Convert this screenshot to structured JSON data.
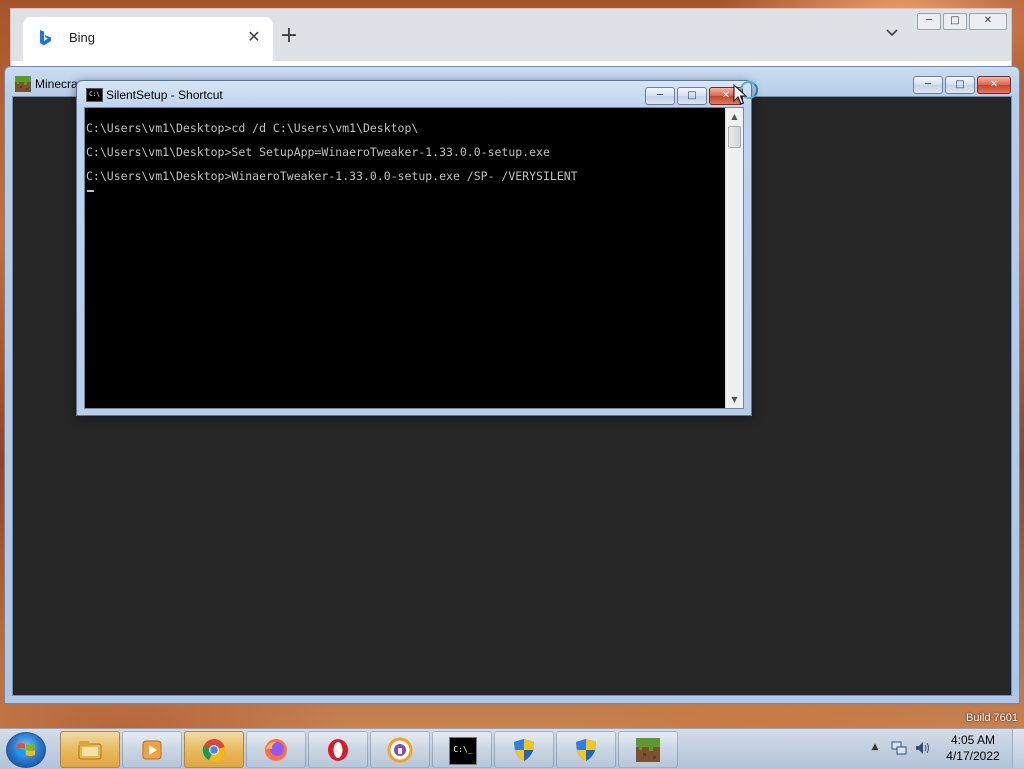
{
  "browser": {
    "tab_title": "Bing",
    "tab_close": "✕",
    "new_tab": "+",
    "tab_menu": "⌄",
    "controls": {
      "minimize": "─",
      "maximize": "□",
      "close": "✕"
    }
  },
  "minecraft_window": {
    "title": "Minecra",
    "controls": {
      "minimize": "─",
      "maximize": "□",
      "close": "✕"
    }
  },
  "console_window": {
    "title": "SilentSetup - Shortcut",
    "icon_text": "C:\\",
    "controls": {
      "minimize": "─",
      "maximize": "□",
      "close": "✕"
    },
    "lines": [
      "C:\\Users\\vm1\\Desktop>cd /d C:\\Users\\vm1\\Desktop\\",
      "C:\\Users\\vm1\\Desktop>Set SetupApp=WinaeroTweaker-1.33.0.0-setup.exe",
      "C:\\Users\\vm1\\Desktop>WinaeroTweaker-1.33.0.0-setup.exe /SP- /VERYSILENT"
    ],
    "scroll_up": "▲",
    "scroll_down": "▼"
  },
  "desktop": {
    "build_text": "Build 7601"
  },
  "taskbar": {
    "items": [
      {
        "name": "explorer",
        "icon": "folder-icon"
      },
      {
        "name": "media-player",
        "icon": "media-icon"
      },
      {
        "name": "chrome",
        "icon": "chrome-icon"
      },
      {
        "name": "firefox",
        "icon": "firefox-icon"
      },
      {
        "name": "opera",
        "icon": "opera-icon"
      },
      {
        "name": "lock-app",
        "icon": "lock-icon"
      },
      {
        "name": "command-prompt",
        "icon": "console-icon",
        "text": "C:\\_"
      },
      {
        "name": "uac-shield-1",
        "icon": "shield-icon"
      },
      {
        "name": "uac-shield-2",
        "icon": "shield-icon"
      },
      {
        "name": "minecraft",
        "icon": "grass-block-icon"
      }
    ],
    "tray": {
      "chevron": "▲",
      "time": "4:05 AM",
      "date": "4/17/2022"
    }
  },
  "colors": {
    "console_bg": "#000000",
    "console_text": "#c0c0c0",
    "minecraft_bg": "#262626",
    "taskbar": "#c1cfdf"
  }
}
